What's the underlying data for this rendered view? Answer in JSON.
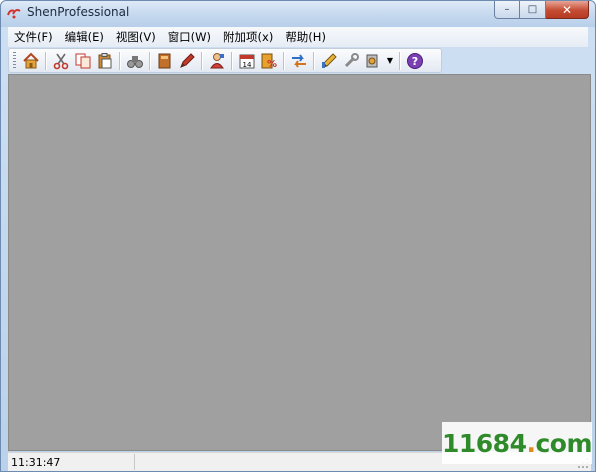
{
  "window": {
    "title": "ShenProfessional",
    "min_label": "–",
    "max_label": "□",
    "close_label": "✕"
  },
  "menubar": {
    "items": [
      {
        "label": "文件(F)"
      },
      {
        "label": "编辑(E)"
      },
      {
        "label": "视图(V)"
      },
      {
        "label": "窗口(W)"
      },
      {
        "label": "附加项(x)"
      },
      {
        "label": "帮助(H)"
      }
    ]
  },
  "toolbar": {
    "buttons": [
      {
        "icon": "home-icon"
      },
      {
        "icon": "cut-icon"
      },
      {
        "icon": "copy-icon"
      },
      {
        "icon": "paste-icon"
      },
      {
        "icon": "binoculars-icon"
      },
      {
        "icon": "book-icon"
      },
      {
        "icon": "pen-icon"
      },
      {
        "icon": "person-icon"
      },
      {
        "icon": "calendar-icon",
        "text": "14"
      },
      {
        "icon": "percent-icon",
        "text": "%"
      },
      {
        "icon": "arrows-icon"
      },
      {
        "icon": "pencil-icon"
      },
      {
        "icon": "wrench-icon"
      },
      {
        "icon": "tools-icon"
      },
      {
        "icon": "help-icon",
        "text": "?"
      }
    ],
    "dropdown_glyph": "▼"
  },
  "statusbar": {
    "time": "11:31:47"
  },
  "watermark": {
    "text_main": "11684",
    "text_dot": ".",
    "text_tld": "com"
  },
  "colors": {
    "client_bg": "#a0a0a0",
    "watermark_green": "#2f8a2a",
    "help_purple": "#7b3fb4"
  }
}
